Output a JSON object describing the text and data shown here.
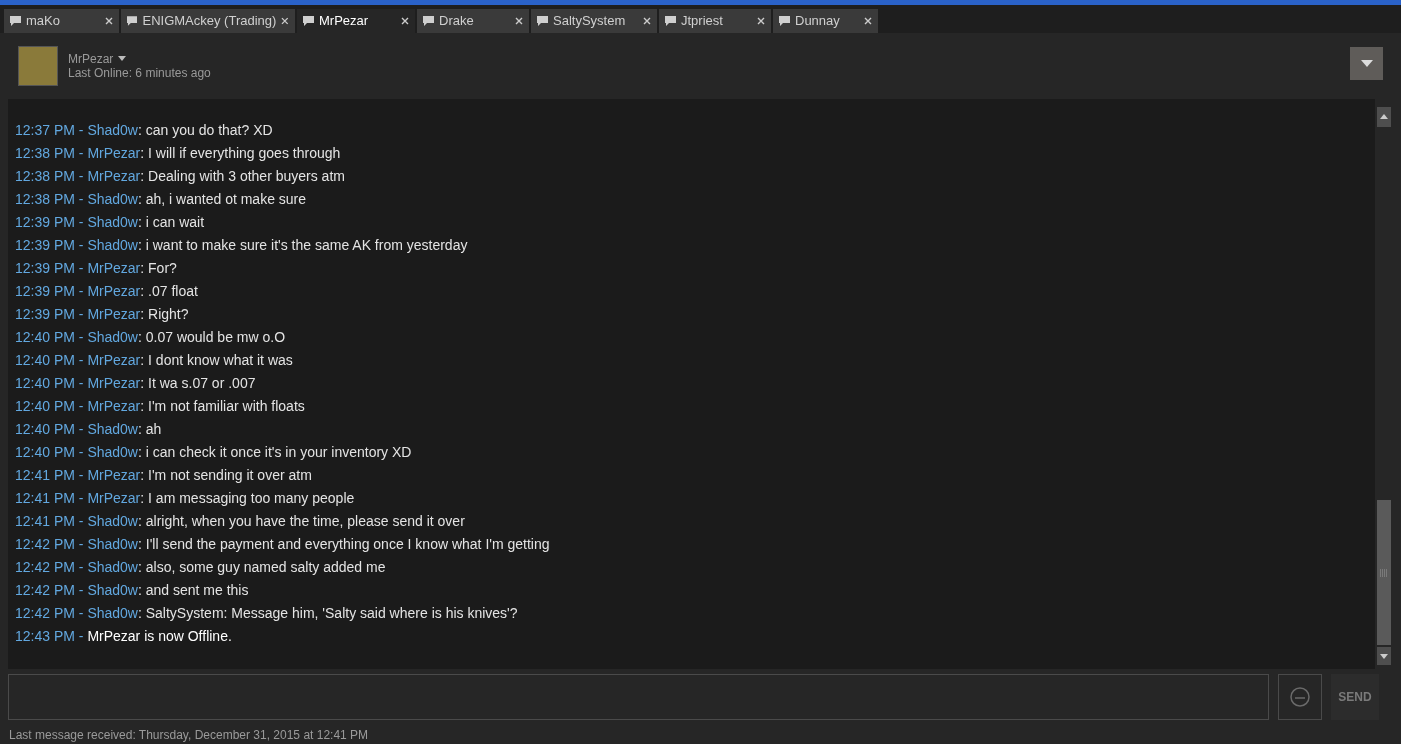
{
  "tabs": [
    {
      "label": "maKo",
      "selected": false
    },
    {
      "label": "ENIGMAckey (Trading)",
      "selected": false
    },
    {
      "label": "MrPezar",
      "selected": true
    },
    {
      "label": "Drake",
      "selected": false
    },
    {
      "label": "SaltySystem",
      "selected": false
    },
    {
      "label": "Jtpriest",
      "selected": false
    },
    {
      "label": "Dunnay",
      "selected": false
    }
  ],
  "header": {
    "name": "MrPezar",
    "status": "Last Online: 6 minutes ago"
  },
  "messages": [
    {
      "kind": "chat",
      "time": "12:37 PM - ",
      "sender": "Shad0w",
      "text": ": can you do that? XD"
    },
    {
      "kind": "chat",
      "time": "12:38 PM - ",
      "sender": "MrPezar",
      "text": ": I will if everything goes through"
    },
    {
      "kind": "chat",
      "time": "12:38 PM - ",
      "sender": "MrPezar",
      "text": ": Dealing with 3 other buyers atm"
    },
    {
      "kind": "chat",
      "time": "12:38 PM - ",
      "sender": "Shad0w",
      "text": ": ah, i wanted ot make sure"
    },
    {
      "kind": "chat",
      "time": "12:39 PM - ",
      "sender": "Shad0w",
      "text": ": i can wait"
    },
    {
      "kind": "chat",
      "time": "12:39 PM - ",
      "sender": "Shad0w",
      "text": ": i want to make sure it's the same AK from yesterday"
    },
    {
      "kind": "chat",
      "time": "12:39 PM - ",
      "sender": "MrPezar",
      "text": ": For?"
    },
    {
      "kind": "chat",
      "time": "12:39 PM - ",
      "sender": "MrPezar",
      "text": ": .07 float"
    },
    {
      "kind": "chat",
      "time": "12:39 PM - ",
      "sender": "MrPezar",
      "text": ": Right?"
    },
    {
      "kind": "chat",
      "time": "12:40 PM - ",
      "sender": "Shad0w",
      "text": ": 0.07 would be mw o.O"
    },
    {
      "kind": "chat",
      "time": "12:40 PM - ",
      "sender": "MrPezar",
      "text": ": I dont know what it was"
    },
    {
      "kind": "chat",
      "time": "12:40 PM - ",
      "sender": "MrPezar",
      "text": ": It wa s.07 or .007"
    },
    {
      "kind": "chat",
      "time": "12:40 PM - ",
      "sender": "MrPezar",
      "text": ": I'm not familiar with floats"
    },
    {
      "kind": "chat",
      "time": "12:40 PM - ",
      "sender": "Shad0w",
      "text": ": ah"
    },
    {
      "kind": "chat",
      "time": "12:40 PM - ",
      "sender": "Shad0w",
      "text": ": i can check it once it's in your inventory XD"
    },
    {
      "kind": "chat",
      "time": "12:41 PM - ",
      "sender": "MrPezar",
      "text": ": I'm not sending it over atm"
    },
    {
      "kind": "chat",
      "time": "12:41 PM - ",
      "sender": "MrPezar",
      "text": ": I am messaging too many people"
    },
    {
      "kind": "chat",
      "time": "12:41 PM - ",
      "sender": "Shad0w",
      "text": ": alright, when you have the time, please send it over"
    },
    {
      "kind": "chat",
      "time": "12:42 PM - ",
      "sender": "Shad0w",
      "text": ": I'll send the payment and everything once I know what I'm getting"
    },
    {
      "kind": "chat",
      "time": "12:42 PM - ",
      "sender": "Shad0w",
      "text": ": also, some guy named salty added me"
    },
    {
      "kind": "chat",
      "time": "12:42 PM - ",
      "sender": "Shad0w",
      "text": ": and sent me this"
    },
    {
      "kind": "chat",
      "time": "12:42 PM - ",
      "sender": "Shad0w",
      "text": ": SaltySystem: Message him, 'Salty said where is his knives'?"
    },
    {
      "kind": "status",
      "time": "12:43 PM - ",
      "text": "MrPezar is now Offline."
    }
  ],
  "send_button": "SEND",
  "footer": "Last message received: Thursday, December 31, 2015 at 12:41 PM"
}
